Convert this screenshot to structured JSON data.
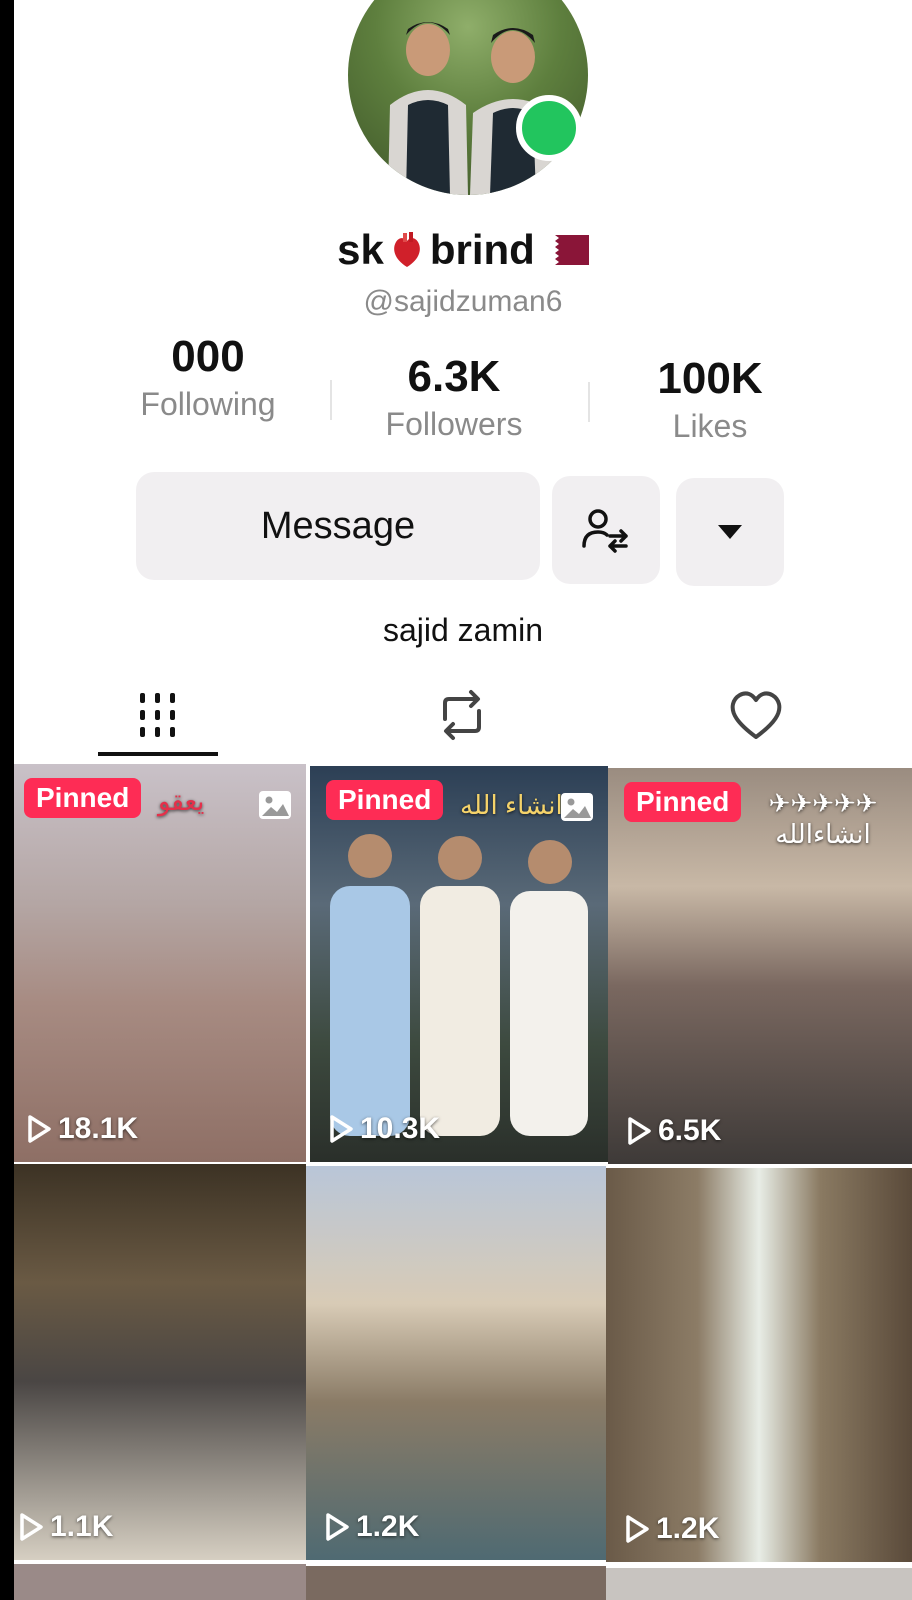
{
  "profile": {
    "display_name_part1": "sk",
    "display_name_part2": "brind",
    "handle": "@sajidzuman6",
    "bio": "sajid zamin",
    "online": true
  },
  "stats": [
    {
      "value": "000",
      "label": "Following"
    },
    {
      "value": "6.3K",
      "label": "Followers"
    },
    {
      "value": "100K",
      "label": "Likes"
    }
  ],
  "actions": {
    "message_label": "Message"
  },
  "tabs": [
    {
      "name": "videos",
      "icon": "grid-icon",
      "active": true
    },
    {
      "name": "reposts",
      "icon": "repost-icon",
      "active": false
    },
    {
      "name": "liked",
      "icon": "heart-outline-icon",
      "active": false
    }
  ],
  "videos": [
    {
      "pinned_label": "Pinned",
      "views": "18.1K",
      "overlay": "يعقو",
      "photo": true
    },
    {
      "pinned_label": "Pinned",
      "views": "10.3K",
      "overlay": "انشاء الله",
      "photo": true
    },
    {
      "pinned_label": "Pinned",
      "views": "6.5K",
      "overlay": "✈✈✈✈✈ انشاءالله",
      "photo": false
    },
    {
      "pinned_label": "",
      "views": "1.1K",
      "overlay": "",
      "photo": false
    },
    {
      "pinned_label": "",
      "views": "1.2K",
      "overlay": "",
      "photo": false
    },
    {
      "pinned_label": "",
      "views": "1.2K",
      "overlay": "",
      "photo": false
    }
  ],
  "colors": {
    "accent": "#fe2c55",
    "online": "#22c55e",
    "button_bg": "#f1eff1",
    "muted_text": "#8a8a8a"
  }
}
